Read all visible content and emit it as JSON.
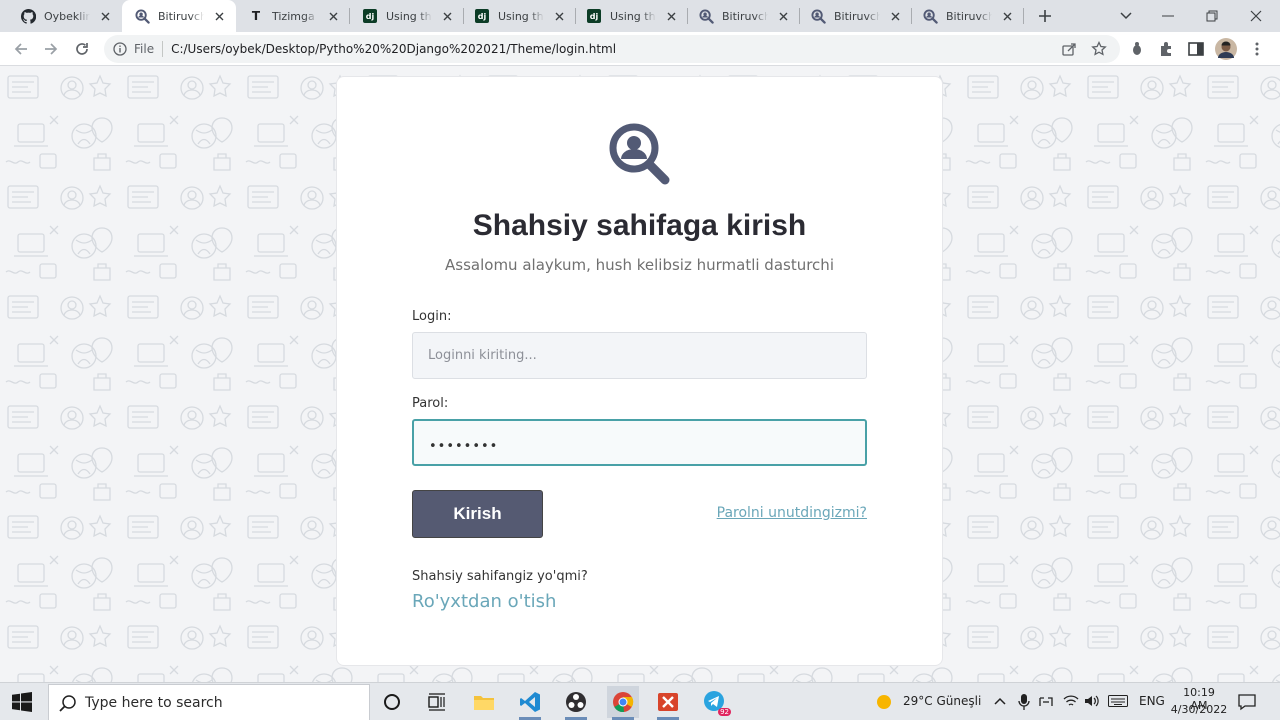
{
  "browser": {
    "tabs": [
      {
        "favicon": "github-icon",
        "title": "Oybeklinux"
      },
      {
        "favicon": "search-user-icon",
        "title": "Bitiruvchi"
      },
      {
        "favicon": "t-letter-icon",
        "title": "Tizimga kirish"
      },
      {
        "favicon": "django-icon",
        "title": "Using the"
      },
      {
        "favicon": "django-icon",
        "title": "Using the"
      },
      {
        "favicon": "django-icon",
        "title": "Using the"
      },
      {
        "favicon": "search-user-icon",
        "title": "Bitiruvchi"
      },
      {
        "favicon": "search-user-icon",
        "title": "Bitiruvchi"
      },
      {
        "favicon": "search-user-icon",
        "title": "Bitiruvchi"
      }
    ],
    "active_tab": 1,
    "address": {
      "scheme_label": "File",
      "url": "C:/Users/oybek/Desktop/Pytho%20%20Django%202021/Theme/login.html"
    }
  },
  "page": {
    "heading": "Shahsiy sahifaga kirish",
    "subheading": "Assalomu alaykum, hush kelibsiz hurmatli dasturchi",
    "login_label": "Login:",
    "login_placeholder": "Loginni kiriting...",
    "password_label": "Parol:",
    "password_mask": "••••••••",
    "submit_label": "Kirish",
    "forgot_link": "Parolni unutdingizmi?",
    "no_account_text": "Shahsiy sahifangiz yo'qmi?",
    "register_link": "Ro'yxtdan o'tish"
  },
  "taskbar": {
    "search_placeholder": "Type here to search",
    "weather": "29°C  Güneşli",
    "language": "ENG",
    "time": "10:19 AM",
    "date": "4/30/2022",
    "telegram_badge": "92"
  },
  "colors": {
    "accent": "#6aa7b9",
    "button": "#555a72",
    "focus_border": "#49a1a7"
  }
}
